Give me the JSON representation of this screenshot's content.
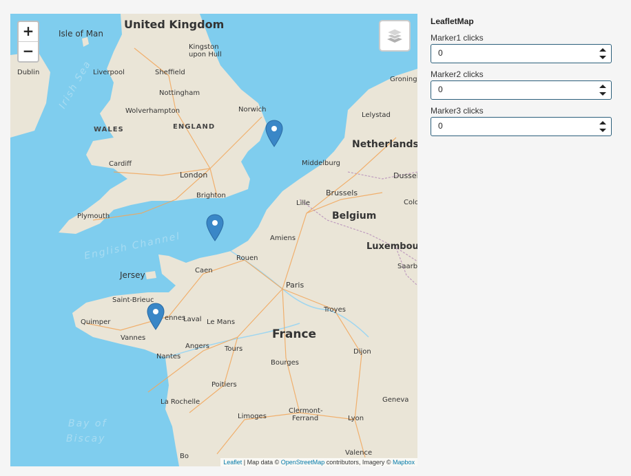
{
  "map": {
    "zoom_in_label": "+",
    "zoom_out_label": "−",
    "layers_icon": "layers-icon",
    "countries": {
      "uk": "United Kingdom",
      "netherlands": "Netherlands",
      "belgium": "Belgium",
      "luxembourg": "Luxembourg",
      "france": "France"
    },
    "regions": {
      "england": "ENGLAND",
      "wales": "WALES"
    },
    "seas": {
      "irish": "Irish Sea",
      "channel": "English Channel",
      "biscay_1": "Bay of",
      "biscay_2": "Biscay"
    },
    "places": {
      "isle_of_man": "Isle of Man",
      "dublin": "Dublin",
      "liverpool": "Liverpool",
      "sheffield": "Sheffield",
      "kingston": "Kingston",
      "upon_hull": "upon Hull",
      "nottingham": "Nottingham",
      "wolverhampton": "Wolverhampton",
      "norwich": "Norwich",
      "cardiff": "Cardiff",
      "london": "London",
      "brighton": "Brighton",
      "plymouth": "Plymouth",
      "jersey": "Jersey",
      "saint_brieuc": "Saint-Brieuc",
      "quimper": "Quimper",
      "vannes": "Vannes",
      "rennes": "ennes",
      "laval": "Laval",
      "le_mans": "Le Mans",
      "nantes": "Nantes",
      "angers": "Angers",
      "tours": "Tours",
      "poitiers": "Poitiers",
      "la_rochelle": "La Rochelle",
      "limoges": "Limoges",
      "clermont_1": "Clermont-",
      "clermont_2": "Ferrand",
      "bourges": "Bourges",
      "dijon": "Dijon",
      "lyon": "Lyon",
      "geneva": "Geneva",
      "valence": "Valence",
      "bo": "Bo",
      "caen": "Caen",
      "rouen": "Rouen",
      "amiens": "Amiens",
      "paris": "Paris",
      "troyes": "Troyes",
      "lille": "Lille",
      "brussels": "Brussels",
      "middelburg": "Middelburg",
      "groningen": "Groning",
      "lelystad": "Lelystad",
      "dusseldorf": "Dussel",
      "cologne": "Colo",
      "saarbrucken": "Saarb"
    },
    "attribution": {
      "leaflet": "Leaflet",
      "sep1": " | Map data © ",
      "osm": "OpenStreetMap",
      "sep2": " contributors, Imagery © ",
      "mapbox": "Mapbox"
    },
    "marker_color": "#3a87c7",
    "markers": [
      {
        "name": "Marker1"
      },
      {
        "name": "Marker2"
      },
      {
        "name": "Marker3"
      }
    ]
  },
  "panel": {
    "title": "LeafletMap",
    "fields": [
      {
        "label": "Marker1 clicks",
        "value": "0"
      },
      {
        "label": "Marker2 clicks",
        "value": "0"
      },
      {
        "label": "Marker3 clicks",
        "value": "0"
      }
    ]
  }
}
